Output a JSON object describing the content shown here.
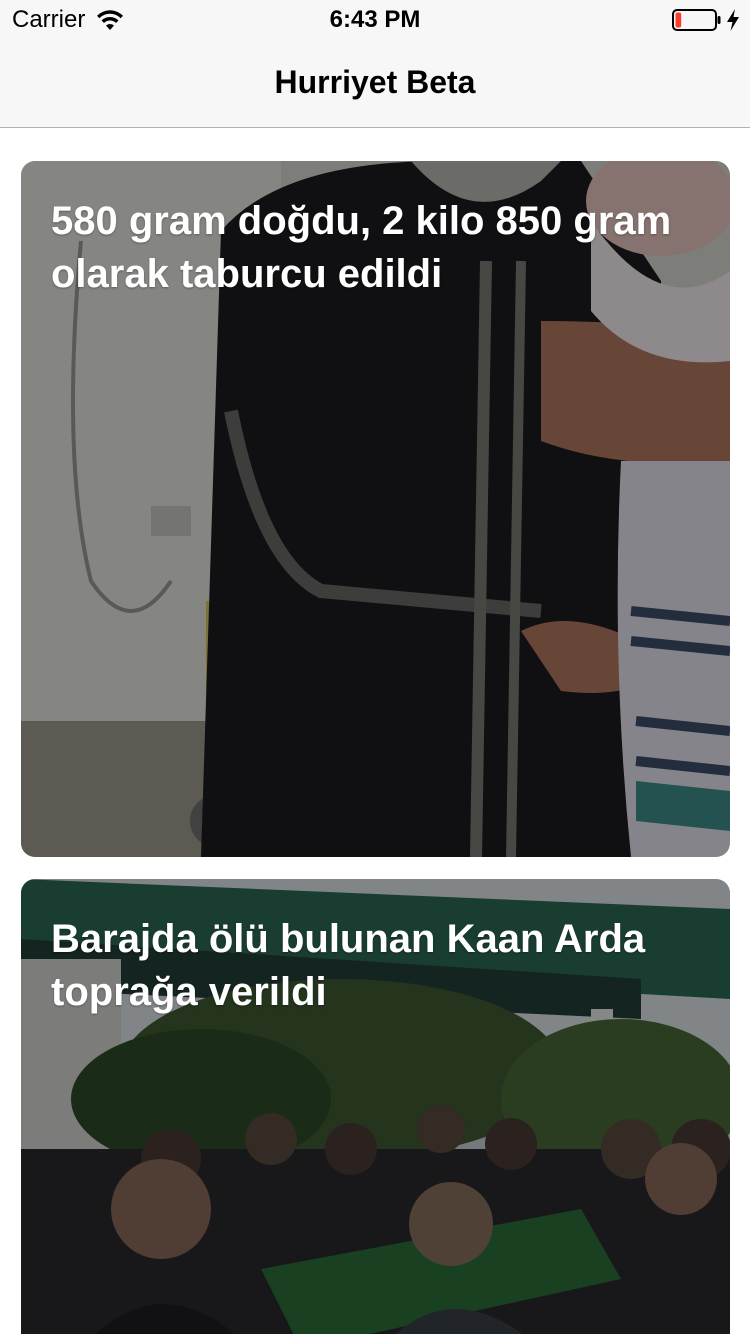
{
  "status_bar": {
    "carrier": "Carrier",
    "time": "6:43 PM",
    "wifi_icon": "wifi-icon",
    "battery_icon": "battery-low-icon",
    "charging_icon": "charging-bolt-icon",
    "battery_level": 0.15,
    "battery_color": "#ff3b30"
  },
  "nav": {
    "title": "Hurriyet Beta"
  },
  "articles": [
    {
      "headline": "580 gram doğdu, 2 kilo 850 gram olarak taburcu edildi",
      "image": "photo-man-in-robe-holding-baby"
    },
    {
      "headline": "Barajda ölü bulunan Kaan Arda toprağa verildi",
      "image": "photo-funeral-crowd-belediyesi-sign"
    }
  ],
  "colors": {
    "bar_background": "#f7f7f7",
    "separator": "#b2b2b2",
    "headline_text": "#ffffff"
  }
}
